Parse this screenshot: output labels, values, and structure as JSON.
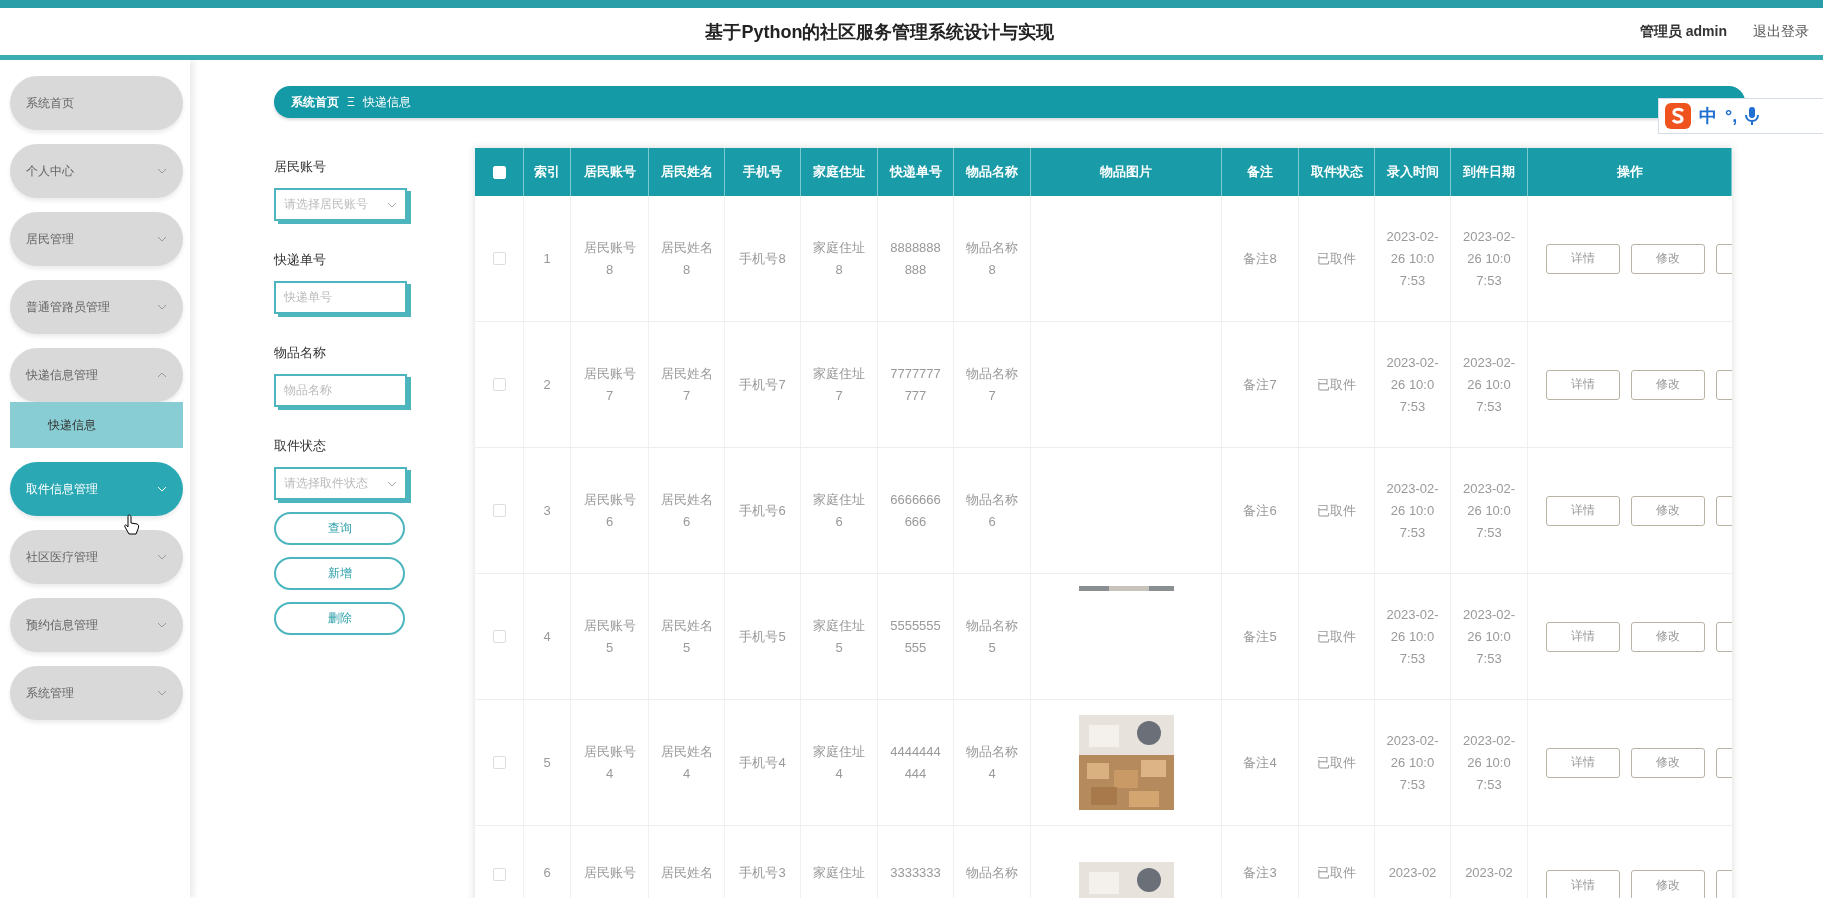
{
  "header": {
    "title": "基于Python的社区服务管理系统设计与实现",
    "user": "管理员 admin",
    "logout": "退出登录"
  },
  "sidebar": {
    "items": [
      {
        "label": "系统首页",
        "kind": "link",
        "selected": false
      },
      {
        "label": "个人中心",
        "kind": "menu",
        "selected": false,
        "expanded": false
      },
      {
        "label": "居民管理",
        "kind": "menu",
        "selected": false,
        "expanded": false
      },
      {
        "label": "普通管路员管理",
        "kind": "menu",
        "selected": false,
        "expanded": false
      },
      {
        "label": "快递信息管理",
        "kind": "menu",
        "selected": false,
        "expanded": true,
        "children": [
          {
            "label": "快递信息",
            "selected": true
          }
        ]
      },
      {
        "label": "取件信息管理",
        "kind": "menu",
        "selected": true,
        "expanded": false
      },
      {
        "label": "社区医疗管理",
        "kind": "menu",
        "selected": false,
        "expanded": false
      },
      {
        "label": "预约信息管理",
        "kind": "menu",
        "selected": false,
        "expanded": false
      },
      {
        "label": "系统管理",
        "kind": "menu",
        "selected": false,
        "expanded": false
      }
    ]
  },
  "breadcrumb": {
    "home": "系统首页",
    "separator": "Ξ",
    "current": "快递信息"
  },
  "filters": [
    {
      "label": "居民账号",
      "kind": "select",
      "placeholder": "请选择居民账号"
    },
    {
      "label": "快递单号",
      "kind": "input",
      "placeholder": "快递单号"
    },
    {
      "label": "物品名称",
      "kind": "input",
      "placeholder": "物品名称"
    },
    {
      "label": "取件状态",
      "kind": "select",
      "placeholder": "请选择取件状态"
    }
  ],
  "actions": [
    "查询",
    "新增",
    "删除"
  ],
  "table": {
    "all_checked": false,
    "columns": [
      "索引",
      "居民账号",
      "居民姓名",
      "手机号",
      "家庭住址",
      "快递单号",
      "物品名称",
      "物品图片",
      "备注",
      "取件状态",
      "录入时间",
      "到件日期",
      "操作"
    ],
    "rows": [
      {
        "checked": false,
        "cells": [
          "1",
          "居民账号8",
          "居民姓名8",
          "手机号8",
          "家庭住址8",
          "8888888888",
          "物品名称8",
          "",
          "备注8",
          "已取件",
          "2023-02-26 10:07:53",
          "2023-02-26 10:07:53"
        ],
        "buttons": [
          "详情",
          "修改"
        ]
      },
      {
        "checked": false,
        "cells": [
          "2",
          "居民账号7",
          "居民姓名7",
          "手机号7",
          "家庭住址7",
          "7777777777",
          "物品名称7",
          "",
          "备注7",
          "已取件",
          "2023-02-26 10:07:53",
          "2023-02-26 10:07:53"
        ],
        "buttons": [
          "详情",
          "修改"
        ]
      },
      {
        "checked": false,
        "cells": [
          "3",
          "居民账号6",
          "居民姓名6",
          "手机号6",
          "家庭住址6",
          "6666666666",
          "物品名称6",
          "",
          "备注6",
          "已取件",
          "2023-02-26 10:07:53",
          "2023-02-26 10:07:53"
        ],
        "buttons": [
          "详情",
          "修改"
        ]
      },
      {
        "checked": false,
        "cells": [
          "4",
          "居民账号5",
          "居民姓名5",
          "手机号5",
          "家庭住址5",
          "5555555555",
          "物品名称5",
          {
            "kind": "strip"
          },
          "备注5",
          "已取件",
          "2023-02-26 10:07:53",
          "2023-02-26 10:07:53"
        ],
        "buttons": [
          "详情",
          "修改"
        ]
      },
      {
        "checked": false,
        "cells": [
          "5",
          "居民账号4",
          "居民姓名4",
          "手机号4",
          "家庭住址4",
          "4444444444",
          "物品名称4",
          {
            "kind": "picture"
          },
          "备注4",
          "已取件",
          "2023-02-26 10:07:53",
          "2023-02-26 10:07:53"
        ],
        "buttons": [
          "详情",
          "修改"
        ]
      },
      {
        "checked": false,
        "cells": [
          "6",
          "居民账号",
          "居民姓名",
          "手机号3",
          "家庭住址",
          "3333333",
          "物品名称",
          {
            "kind": "picture"
          },
          "备注3",
          "已取件",
          "2023-02",
          "2023-02"
        ],
        "buttons": [
          "详情",
          "修改"
        ]
      }
    ]
  },
  "ime_toolbar": {
    "mode": "中",
    "punctuation": "°,"
  }
}
